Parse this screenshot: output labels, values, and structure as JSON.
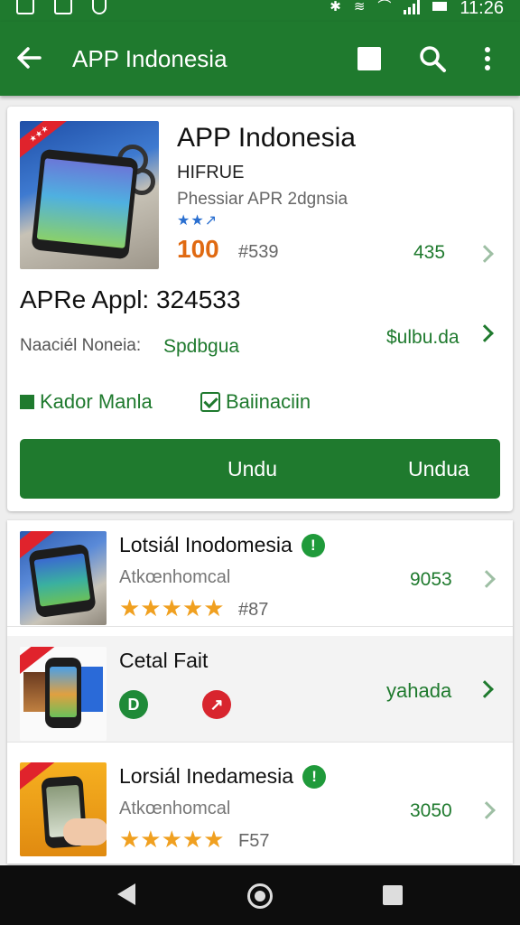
{
  "colors": {
    "brand": "#1f7a2e",
    "accent_orange": "#e06a12",
    "star": "#f0a020"
  },
  "status_bar": {
    "time": "11:26",
    "icons": [
      "image-icon",
      "chart-icon",
      "location-icon",
      "bluetooth-icon",
      "vibrate-icon",
      "wifi-icon",
      "signal-icon",
      "battery-icon"
    ]
  },
  "app_bar": {
    "title": "APP Indonesia",
    "icons": [
      "back-arrow-icon",
      "square-icon",
      "search-icon",
      "more-icon"
    ]
  },
  "detail": {
    "title": "APP Indonesia",
    "developer": "HIFRUE",
    "subtitle": "Phessiar APR 2dgnsia",
    "stars": "★★↗",
    "score": "100",
    "rank": "#539",
    "count": "435",
    "headline": "APRe Appl: 324533",
    "info_label": "Naaciél Noneia:",
    "info_value": "Spdbgua",
    "price_link": "$ulbu.da",
    "option_1": "Kador Manla",
    "option_2": "Baiinaciin",
    "download_left": "Undu",
    "download_right": "Undua"
  },
  "list": [
    {
      "title": "Lotsiál Inodomesia",
      "badge": "!",
      "subtitle": "Atkœnhomcal",
      "stars": "★★★★★",
      "rank": "#87",
      "count": "9053"
    },
    {
      "title": "Cetal Fait",
      "link": "yahada",
      "circle_1": "D",
      "circle_2": "↗"
    },
    {
      "title": "Lorsiál Inedamesia",
      "badge": "!",
      "subtitle": "Atkœnhomcal",
      "stars": "★★★★★",
      "rank": "F57",
      "count": "3050"
    }
  ],
  "nav_bar": {
    "icons": [
      "back-triangle-icon",
      "home-circle-icon",
      "recents-square-icon"
    ]
  }
}
